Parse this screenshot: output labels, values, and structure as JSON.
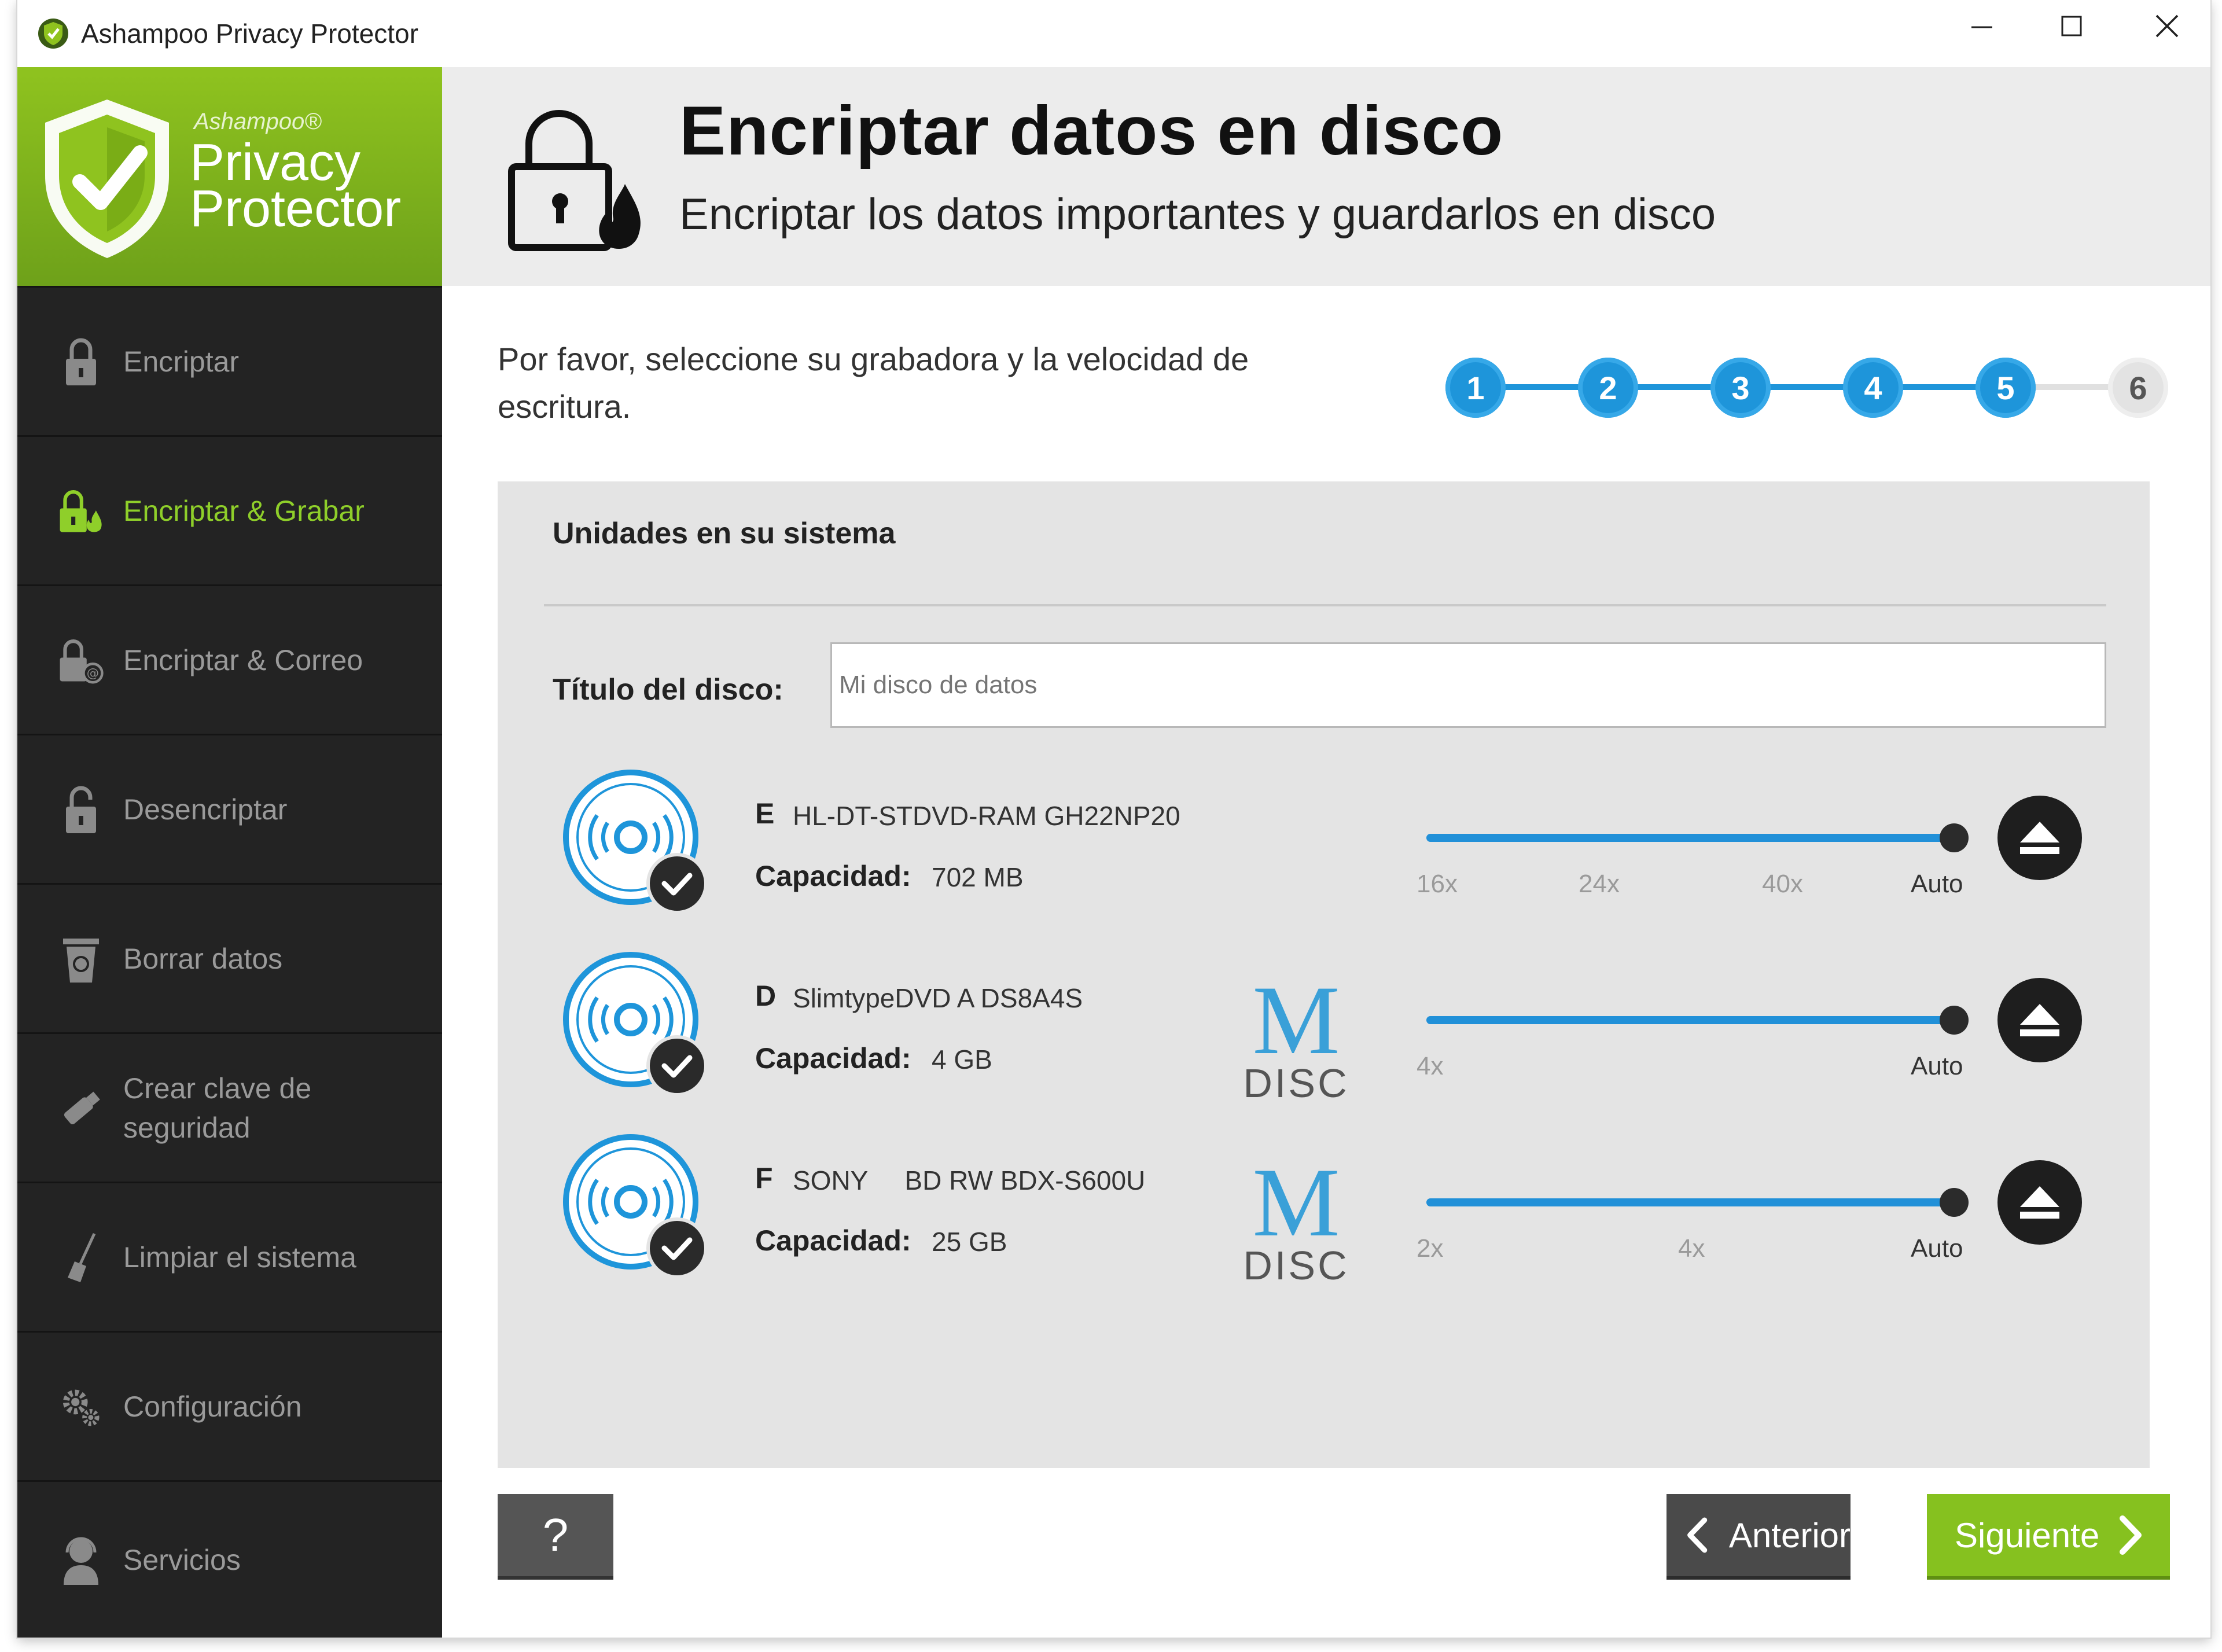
{
  "window": {
    "title": "Ashampoo Privacy Protector"
  },
  "brand": {
    "company": "Ashampoo®",
    "product_line1": "Privacy",
    "product_line2": "Protector",
    "accent_color": "#8fc31f"
  },
  "sidebar": {
    "items": [
      {
        "label": "Encriptar",
        "icon": "lock-icon",
        "active": false
      },
      {
        "label": "Encriptar & Grabar",
        "icon": "lock-flame-icon",
        "active": true
      },
      {
        "label": "Encriptar &  Correo",
        "icon": "lock-mail-icon",
        "active": false
      },
      {
        "label": "Desencriptar",
        "icon": "unlock-icon",
        "active": false
      },
      {
        "label": "Borrar datos",
        "icon": "trash-icon",
        "active": false
      },
      {
        "label": "Crear clave de seguridad",
        "icon": "usb-key-icon",
        "active": false
      },
      {
        "label": "Limpiar el sistema",
        "icon": "broom-icon",
        "active": false
      },
      {
        "label": "Configuración",
        "icon": "gears-icon",
        "active": false
      },
      {
        "label": "Servicios",
        "icon": "support-icon",
        "active": false
      }
    ]
  },
  "header": {
    "title": "Encriptar datos en disco",
    "subtitle": "Encriptar los datos importantes y guardarlos en disco"
  },
  "main": {
    "prompt": "Por favor, seleccione su grabadora y la velocidad de escritura.",
    "steps": [
      {
        "label": "1",
        "done": true
      },
      {
        "label": "2",
        "done": true
      },
      {
        "label": "3",
        "done": true
      },
      {
        "label": "4",
        "done": true
      },
      {
        "label": "5",
        "done": true
      },
      {
        "label": "6",
        "done": false
      }
    ],
    "panel_title": "Unidades en su sistema",
    "disc_title_label": "Título del disco:",
    "disc_title_placeholder": "Mi disco de datos",
    "capacity_label": "Capacidad:",
    "drives": [
      {
        "letter": "E",
        "model": "HL-DT-STDVD-RAM GH22NP20",
        "capacity": "702 MB",
        "mdisc": false,
        "speeds": [
          "16x",
          "24x",
          "40x",
          "Auto"
        ],
        "selected_speed": "Auto"
      },
      {
        "letter": "D",
        "model": "SlimtypeDVD A  DS8A4S",
        "capacity": "4 GB",
        "mdisc": true,
        "speeds": [
          "4x",
          "Auto"
        ],
        "selected_speed": "Auto"
      },
      {
        "letter": "F",
        "model": "SONY     BD RW BDX-S600U",
        "capacity": "25 GB",
        "mdisc": true,
        "speeds": [
          "2x",
          "4x",
          "Auto"
        ],
        "selected_speed": "Auto"
      }
    ],
    "mdisc_text": {
      "m": "M",
      "disc": "DISC"
    }
  },
  "footer": {
    "help_label": "?",
    "prev_label": "Anterior",
    "next_label": "Siguiente"
  },
  "colors": {
    "step_blue": "#1e95da",
    "slider_blue": "#2190d8",
    "next_green": "#86c11f",
    "sidebar_bg": "#232323"
  }
}
